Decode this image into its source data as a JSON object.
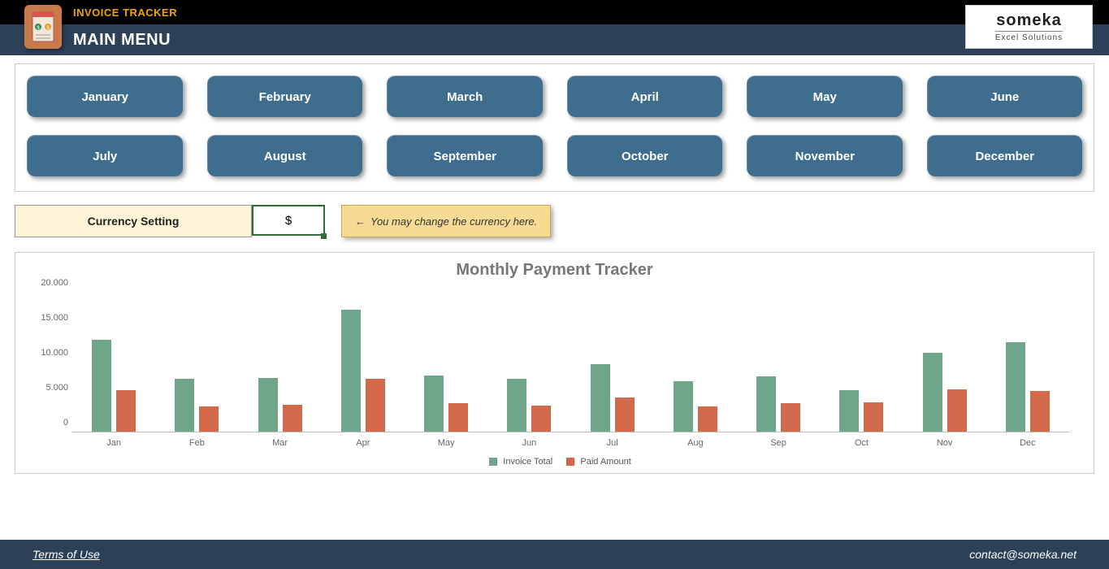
{
  "header": {
    "app_title": "INVOICE TRACKER",
    "page_title": "MAIN MENU"
  },
  "logo": {
    "line1": "someka",
    "line2": "Excel Solutions"
  },
  "months_row1": [
    "January",
    "February",
    "March",
    "April",
    "May",
    "June"
  ],
  "months_row2": [
    "July",
    "August",
    "September",
    "October",
    "November",
    "December"
  ],
  "currency": {
    "label": "Currency Setting",
    "value": "$",
    "hint": "You may change the currency here."
  },
  "footer": {
    "terms": "Terms of Use",
    "contact": "contact@someka.net"
  },
  "chart_data": {
    "type": "bar",
    "title": "Monthly Payment Tracker",
    "xlabel": "",
    "ylabel": "",
    "ylim": [
      0,
      20000
    ],
    "yticks_labels": [
      "0",
      "5.000",
      "10.000",
      "15.000",
      "20.000"
    ],
    "categories": [
      "Jan",
      "Feb",
      "Mar",
      "Apr",
      "May",
      "Jun",
      "Jul",
      "Aug",
      "Sep",
      "Oct",
      "Nov",
      "Dec"
    ],
    "series": [
      {
        "name": "Invoice Total",
        "color": "#6fa58b",
        "values": [
          12800,
          7300,
          7500,
          17000,
          7800,
          7400,
          9400,
          7000,
          7700,
          5800,
          11000,
          12400
        ]
      },
      {
        "name": "Paid Amount",
        "color": "#d16a4a",
        "values": [
          5800,
          3500,
          3700,
          7400,
          4000,
          3600,
          4800,
          3500,
          4000,
          4100,
          5900,
          5700
        ]
      }
    ],
    "legend_position": "bottom",
    "grid": false
  }
}
